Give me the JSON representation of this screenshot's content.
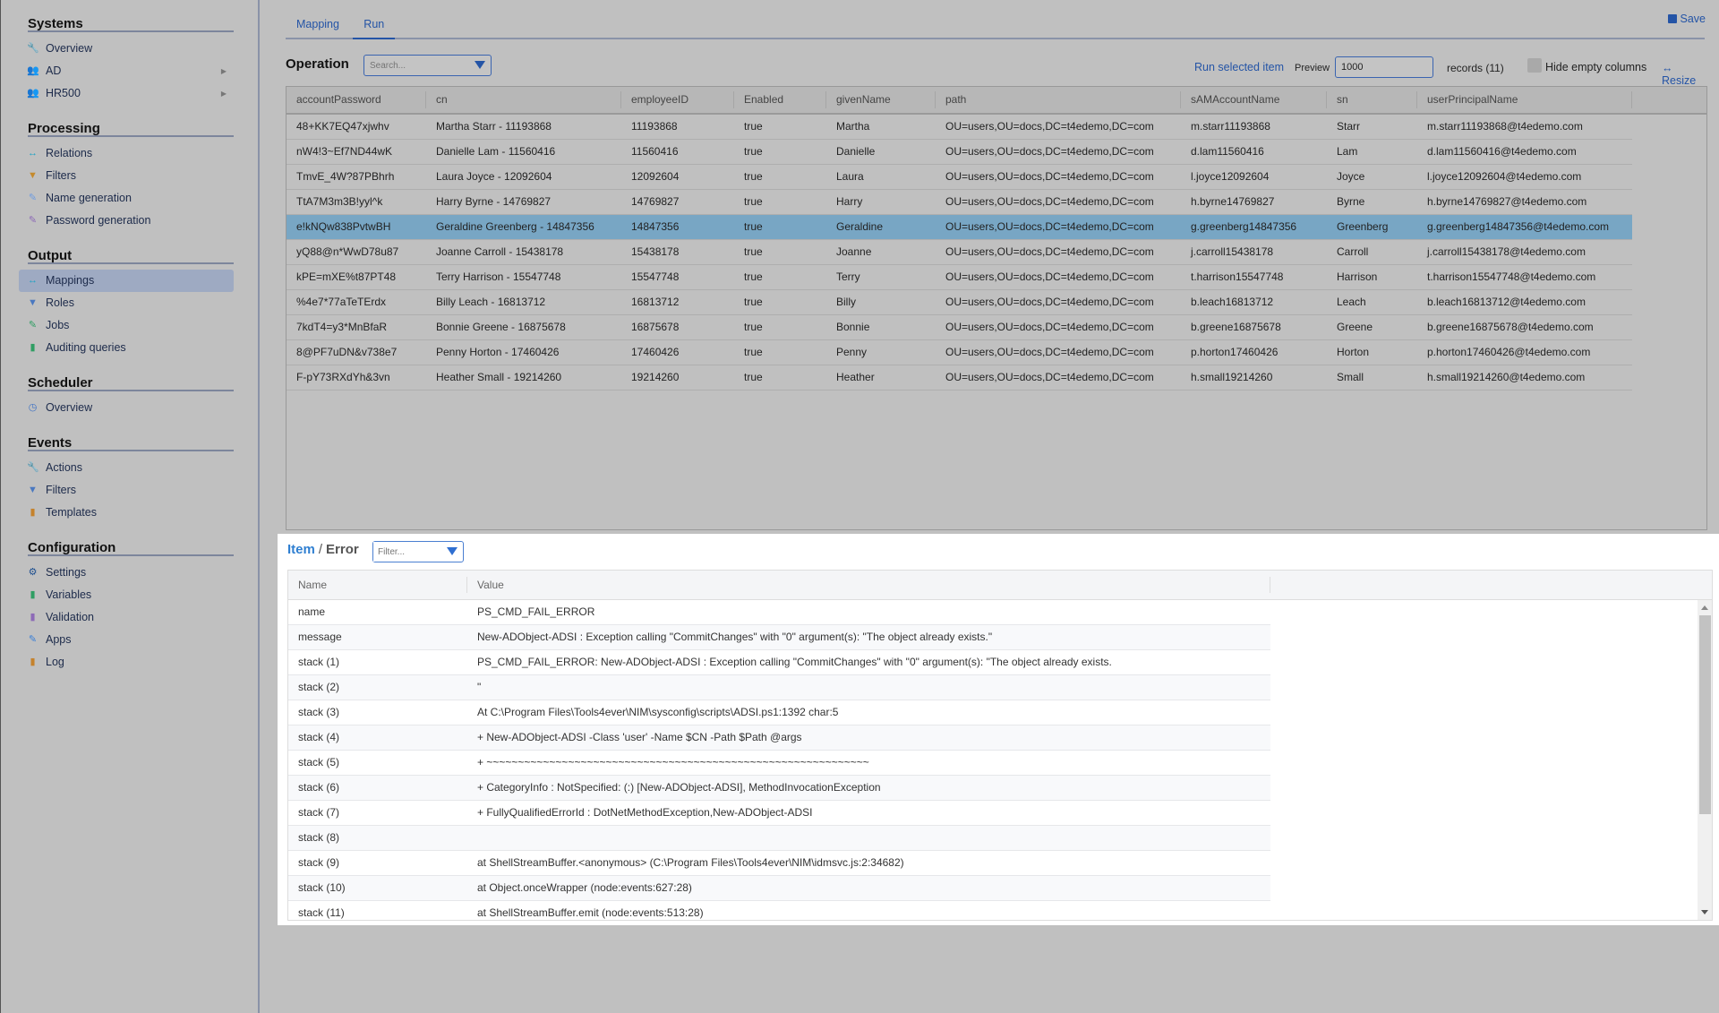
{
  "sidebar": {
    "sections": [
      {
        "title": "Systems",
        "items": [
          {
            "label": "Overview",
            "icon": "wrench-icon",
            "glyph": "🔧",
            "color": "#2d6fd6"
          },
          {
            "label": "AD",
            "icon": "users-icon",
            "glyph": "👥",
            "color": "#7a3fb0",
            "arrow": true
          },
          {
            "label": "HR500",
            "icon": "users-icon",
            "glyph": "👥",
            "color": "#7a3fb0",
            "arrow": true
          }
        ]
      },
      {
        "title": "Processing",
        "items": [
          {
            "label": "Relations",
            "icon": "arrows-horizontal-icon",
            "glyph": "↔",
            "color": "#1fa3c4"
          },
          {
            "label": "Filters",
            "icon": "filter-icon",
            "glyph": "▼",
            "color": "#c58a2c"
          },
          {
            "label": "Name generation",
            "icon": "edit-file-icon",
            "glyph": "✎",
            "color": "#6d9be0"
          },
          {
            "label": "Password generation",
            "icon": "edit-file-icon",
            "glyph": "✎",
            "color": "#8d6ab7"
          }
        ]
      },
      {
        "title": "Output",
        "items": [
          {
            "label": "Mappings",
            "icon": "arrows-horizontal-icon",
            "glyph": "↔",
            "color": "#1fa3c4",
            "active": true
          },
          {
            "label": "Roles",
            "icon": "filter-icon",
            "glyph": "▼",
            "color": "#4a78c0"
          },
          {
            "label": "Jobs",
            "icon": "edit-file-icon",
            "glyph": "✎",
            "color": "#2f9e63"
          },
          {
            "label": "Auditing queries",
            "icon": "file-icon",
            "glyph": "▮",
            "color": "#2f9e63"
          }
        ]
      },
      {
        "title": "Scheduler",
        "items": [
          {
            "label": "Overview",
            "icon": "clock-icon",
            "glyph": "◷",
            "color": "#3a6fc4"
          }
        ]
      },
      {
        "title": "Events",
        "items": [
          {
            "label": "Actions",
            "icon": "wrench-icon",
            "glyph": "🔧",
            "color": "#8d4fc4"
          },
          {
            "label": "Filters",
            "icon": "filter-icon",
            "glyph": "▼",
            "color": "#4a78c0"
          },
          {
            "label": "Templates",
            "icon": "file-icon",
            "glyph": "▮",
            "color": "#c5822c"
          }
        ]
      },
      {
        "title": "Configuration",
        "items": [
          {
            "label": "Settings",
            "icon": "gear-icon",
            "glyph": "⚙",
            "color": "#1d4f8f"
          },
          {
            "label": "Variables",
            "icon": "file-icon",
            "glyph": "▮",
            "color": "#2f9e63"
          },
          {
            "label": "Validation",
            "icon": "file-icon",
            "glyph": "▮",
            "color": "#8d6ab7"
          },
          {
            "label": "Apps",
            "icon": "edit-file-icon",
            "glyph": "✎",
            "color": "#3a7fd6"
          },
          {
            "label": "Log",
            "icon": "file-icon",
            "glyph": "▮",
            "color": "#c5822c"
          }
        ]
      }
    ]
  },
  "tabs": [
    {
      "label": "Mapping",
      "active": false
    },
    {
      "label": "Run",
      "active": true
    }
  ],
  "toolbar": {
    "save_label": "Save",
    "operation_title": "Operation",
    "search_placeholder": "Search...",
    "run_selected_label": "Run selected item",
    "preview_label": "Preview",
    "preview_value": "1000",
    "records_label": "records (11)",
    "hide_empty_label": "Hide empty columns",
    "hide_empty_checked": false,
    "resize_label": "↔ Resize"
  },
  "grid": {
    "columns": [
      "accountPassword",
      "cn",
      "employeeID",
      "Enabled",
      "givenName",
      "path",
      "sAMAccountName",
      "sn",
      "userPrincipalName"
    ],
    "selected_index": 4,
    "rows": [
      [
        "48+KK7EQ47xjwhv",
        "Martha Starr - 11193868",
        "11193868",
        "true",
        "Martha",
        "OU=users,OU=docs,DC=t4edemo,DC=com",
        "m.starr11193868",
        "Starr",
        "m.starr11193868@t4edemo.com"
      ],
      [
        "nW4!3~Ef7ND44wK",
        "Danielle Lam - 11560416",
        "11560416",
        "true",
        "Danielle",
        "OU=users,OU=docs,DC=t4edemo,DC=com",
        "d.lam11560416",
        "Lam",
        "d.lam11560416@t4edemo.com"
      ],
      [
        "TmvE_4W?87PBhrh",
        "Laura Joyce - 12092604",
        "12092604",
        "true",
        "Laura",
        "OU=users,OU=docs,DC=t4edemo,DC=com",
        "l.joyce12092604",
        "Joyce",
        "l.joyce12092604@t4edemo.com"
      ],
      [
        "TtA7M3m3B!yyl^k",
        "Harry Byrne - 14769827",
        "14769827",
        "true",
        "Harry",
        "OU=users,OU=docs,DC=t4edemo,DC=com",
        "h.byrne14769827",
        "Byrne",
        "h.byrne14769827@t4edemo.com"
      ],
      [
        "e!kNQw838PvtwBH",
        "Geraldine Greenberg - 14847356",
        "14847356",
        "true",
        "Geraldine",
        "OU=users,OU=docs,DC=t4edemo,DC=com",
        "g.greenberg14847356",
        "Greenberg",
        "g.greenberg14847356@t4edemo.com"
      ],
      [
        "yQ88@n*WwD78u87",
        "Joanne Carroll - 15438178",
        "15438178",
        "true",
        "Joanne",
        "OU=users,OU=docs,DC=t4edemo,DC=com",
        "j.carroll15438178",
        "Carroll",
        "j.carroll15438178@t4edemo.com"
      ],
      [
        "kPE=mXE%t87PT48",
        "Terry Harrison - 15547748",
        "15547748",
        "true",
        "Terry",
        "OU=users,OU=docs,DC=t4edemo,DC=com",
        "t.harrison15547748",
        "Harrison",
        "t.harrison15547748@t4edemo.com"
      ],
      [
        "%4e7*77aTeTErdx",
        "Billy Leach - 16813712",
        "16813712",
        "true",
        "Billy",
        "OU=users,OU=docs,DC=t4edemo,DC=com",
        "b.leach16813712",
        "Leach",
        "b.leach16813712@t4edemo.com"
      ],
      [
        "7kdT4=y3*MnBfaR",
        "Bonnie Greene - 16875678",
        "16875678",
        "true",
        "Bonnie",
        "OU=users,OU=docs,DC=t4edemo,DC=com",
        "b.greene16875678",
        "Greene",
        "b.greene16875678@t4edemo.com"
      ],
      [
        "8@PF7uDN&v738e7",
        "Penny Horton - 17460426",
        "17460426",
        "true",
        "Penny",
        "OU=users,OU=docs,DC=t4edemo,DC=com",
        "p.horton17460426",
        "Horton",
        "p.horton17460426@t4edemo.com"
      ],
      [
        "F-pY73RXdYh&3vn",
        "Heather Small - 19214260",
        "19214260",
        "true",
        "Heather",
        "OU=users,OU=docs,DC=t4edemo,DC=com",
        "h.small19214260",
        "Small",
        "h.small19214260@t4edemo.com"
      ]
    ]
  },
  "detail": {
    "title_item": "Item",
    "title_sep": "/",
    "title_error": "Error",
    "filter_placeholder": "Filter...",
    "columns": [
      "Name",
      "Value"
    ],
    "rows": [
      [
        "name",
        "PS_CMD_FAIL_ERROR"
      ],
      [
        "message",
        "New-ADObject-ADSI : Exception calling \"CommitChanges\" with \"0\" argument(s): \"The object already exists.\""
      ],
      [
        "stack (1)",
        "PS_CMD_FAIL_ERROR: New-ADObject-ADSI : Exception calling \"CommitChanges\" with \"0\" argument(s): \"The object already exists."
      ],
      [
        "stack (2)",
        "\""
      ],
      [
        "stack (3)",
        "At C:\\Program Files\\Tools4ever\\NIM\\sysconfig\\scripts\\ADSI.ps1:1392 char:5"
      ],
      [
        "stack (4)",
        "+ New-ADObject-ADSI -Class 'user' -Name $CN -Path $Path @args"
      ],
      [
        "stack (5)",
        "+ ~~~~~~~~~~~~~~~~~~~~~~~~~~~~~~~~~~~~~~~~~~~~~~~~~~~~~~~~~~~~~"
      ],
      [
        "stack (6)",
        "+ CategoryInfo : NotSpecified: (:) [New-ADObject-ADSI], MethodInvocationException"
      ],
      [
        "stack (7)",
        "+ FullyQualifiedErrorId : DotNetMethodException,New-ADObject-ADSI"
      ],
      [
        "stack (8)",
        ""
      ],
      [
        "stack (9)",
        "at ShellStreamBuffer.<anonymous> (C:\\Program Files\\Tools4ever\\NIM\\idmsvc.js:2:34682)"
      ],
      [
        "stack (10)",
        "at Object.onceWrapper (node:events:627:28)"
      ],
      [
        "stack (11)",
        "at ShellStreamBuffer.emit (node:events:513:28)"
      ]
    ]
  }
}
